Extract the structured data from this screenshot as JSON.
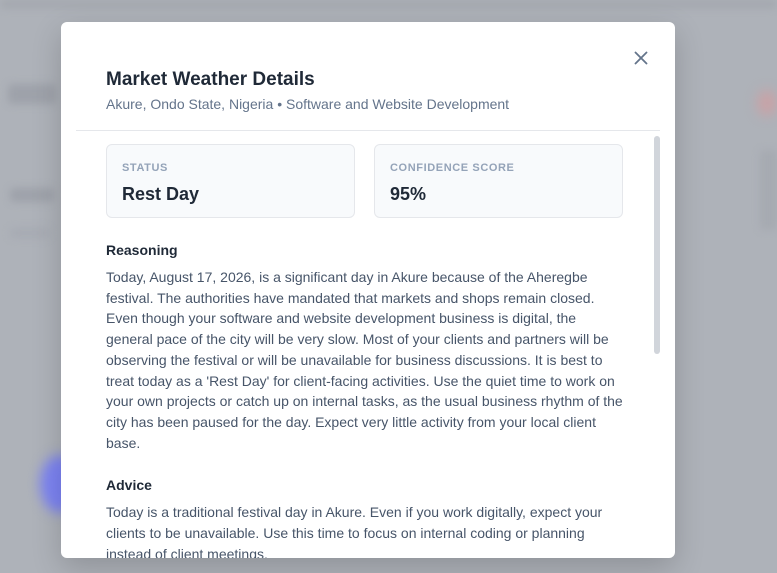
{
  "modal": {
    "title": "Market Weather Details",
    "subtitle": "Akure, Ondo State, Nigeria • Software and Website Development",
    "close_icon": "close-icon"
  },
  "status_card": {
    "label": "STATUS",
    "value": "Rest Day"
  },
  "confidence_card": {
    "label": "CONFIDENCE SCORE",
    "value": "95%"
  },
  "reasoning": {
    "heading": "Reasoning",
    "body": "Today, August 17, 2026, is a significant day in Akure because of the Aheregbe festival. The authorities have mandated that markets and shops remain closed. Even though your software and website development business is digital, the general pace of the city will be very slow. Most of your clients and partners will be observing the festival or will be unavailable for business discussions. It is best to treat today as a 'Rest Day' for client-facing activities. Use the quiet time to work on your own projects or catch up on internal tasks, as the usual business rhythm of the city has been paused for the day. Expect very little activity from your local client base."
  },
  "advice": {
    "heading": "Advice",
    "body": "Today is a traditional festival day in Akure. Even if you work digitally, expect your clients to be unavailable. Use this time to focus on internal coding or planning instead of client meetings."
  },
  "colors": {
    "overlay": "#aeb2b9",
    "title": "#1f2937",
    "muted": "#64748b",
    "card_bg": "#f8fafc",
    "accent_blob": "#7c83f3"
  }
}
